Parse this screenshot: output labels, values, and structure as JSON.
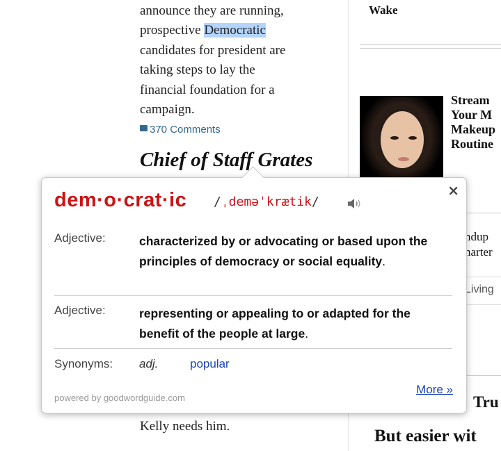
{
  "article": {
    "paragraph_lines": [
      "announce they are running,",
      "prospective ",
      "Democratic",
      "candidates for president are",
      "taking steps to lay the",
      "financial foundation for a",
      "campaign."
    ],
    "comments_count": "370 Comments",
    "headline": "Chief of Staff Grates",
    "bottom_line": "Kelly needs him."
  },
  "right_column": {
    "top_word": "Wake",
    "promo_lines": [
      "Stream",
      "Your M",
      "Makeup",
      "Routine"
    ],
    "snippet_lines": [
      "ndup",
      "narter"
    ],
    "section_label": "Living",
    "headline_a": "Tru",
    "headline_b": "But easier wit"
  },
  "popup": {
    "headword": "dem·o·crat·ic",
    "pron_open": "/",
    "pronunciation": "ˌdeməˈkrætik",
    "pron_close": "/",
    "close_symbol": "×",
    "definitions": [
      {
        "pos": "Adjective:",
        "text": "characterized by or advocating or based upon the principles of democracy or social equality",
        "end": "."
      },
      {
        "pos": "Adjective:",
        "text": "representing or appealing to or adapted for the benefit of the people at large",
        "end": "."
      }
    ],
    "synonyms_label": "Synonyms:",
    "synonyms_pos": "adj.",
    "synonym_word": "popular",
    "more_label": "More »",
    "powered_by": "powered by goodwordguide.com",
    "headword_color": "#cc1414",
    "link_color": "#1a44b8"
  },
  "icons": [
    "comment-icon",
    "close-icon",
    "speaker-icon"
  ]
}
